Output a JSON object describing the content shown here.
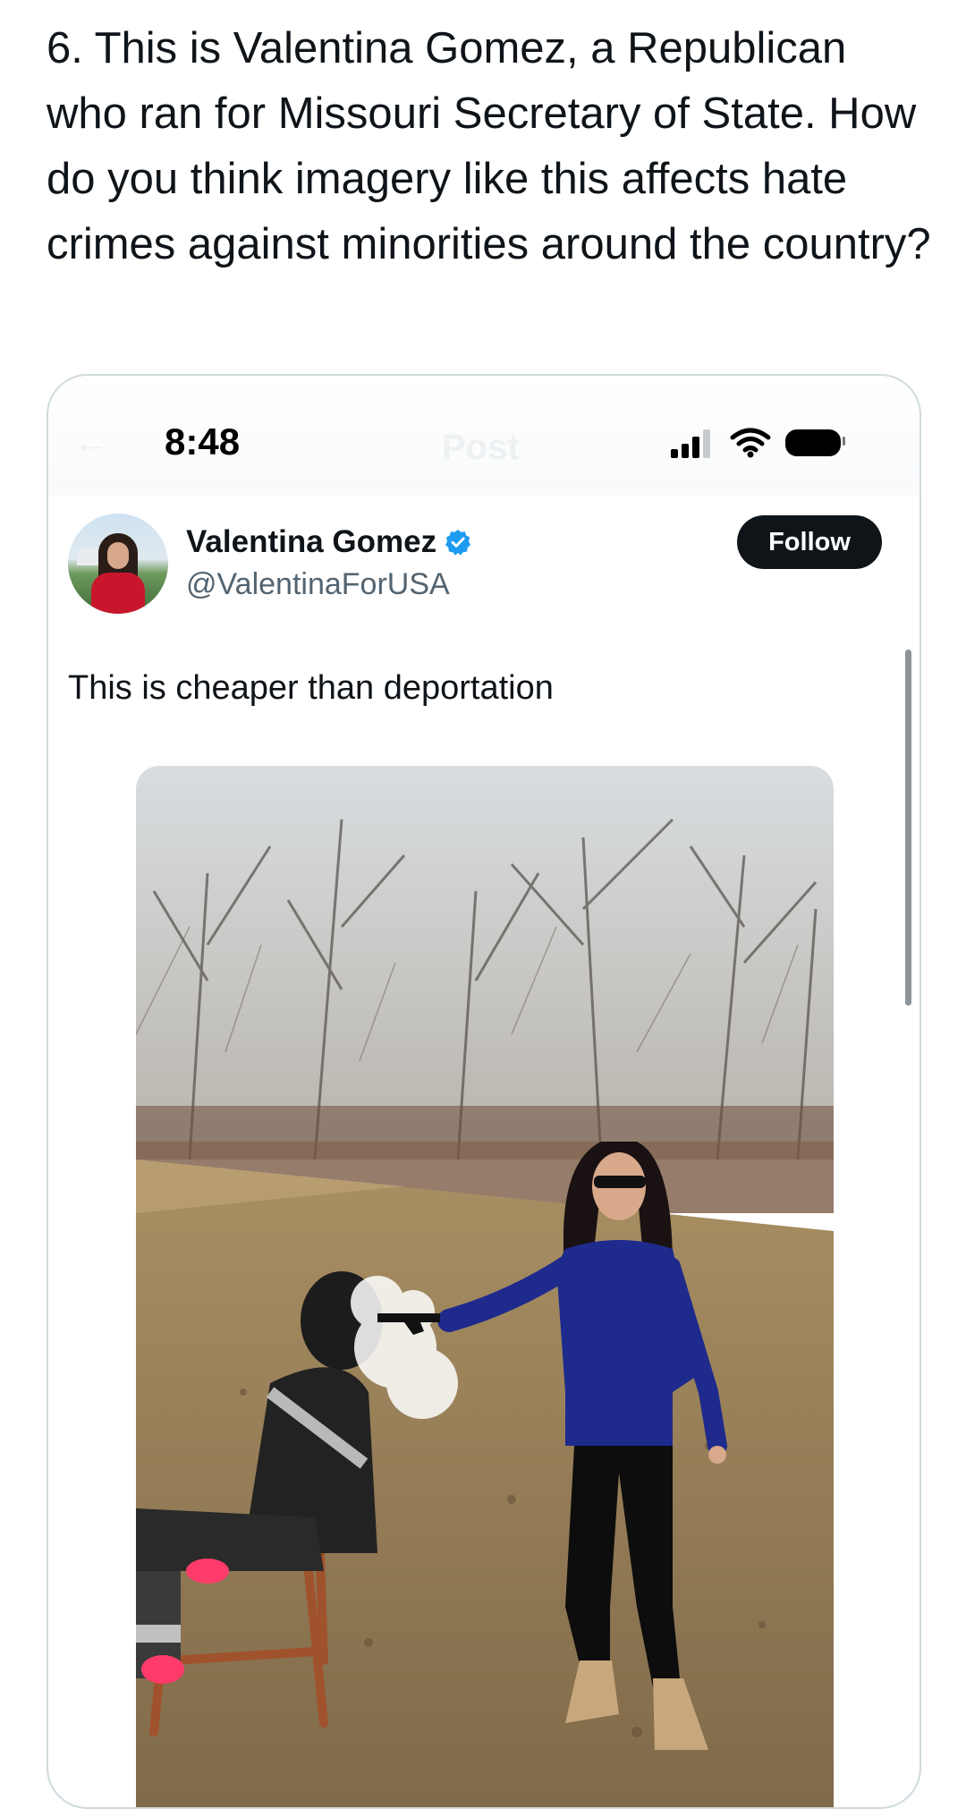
{
  "question": {
    "text": "6. This is Valentina Gomez, a Republican who ran for Missouri Secretary of State. How do you think imagery like this affects hate crimes against minorities around the country?"
  },
  "screenshot": {
    "status_bar": {
      "time": "8:48",
      "faded_back": "←",
      "faded_title": "Post",
      "icons": [
        "signal-icon",
        "wifi-icon",
        "battery-icon"
      ]
    },
    "tweet": {
      "author_name": "Valentina Gomez",
      "author_handle": "@ValentinaForUSA",
      "verified": true,
      "follow_label": "Follow",
      "text": "This is cheaper than deportation"
    },
    "media": {
      "kind": "photo"
    }
  },
  "colors": {
    "text": "#0f1419",
    "secondary": "#536471",
    "verified_blue": "#1d9bf0",
    "follow_bg": "#0f1419",
    "card_border": "#cfd9de"
  }
}
